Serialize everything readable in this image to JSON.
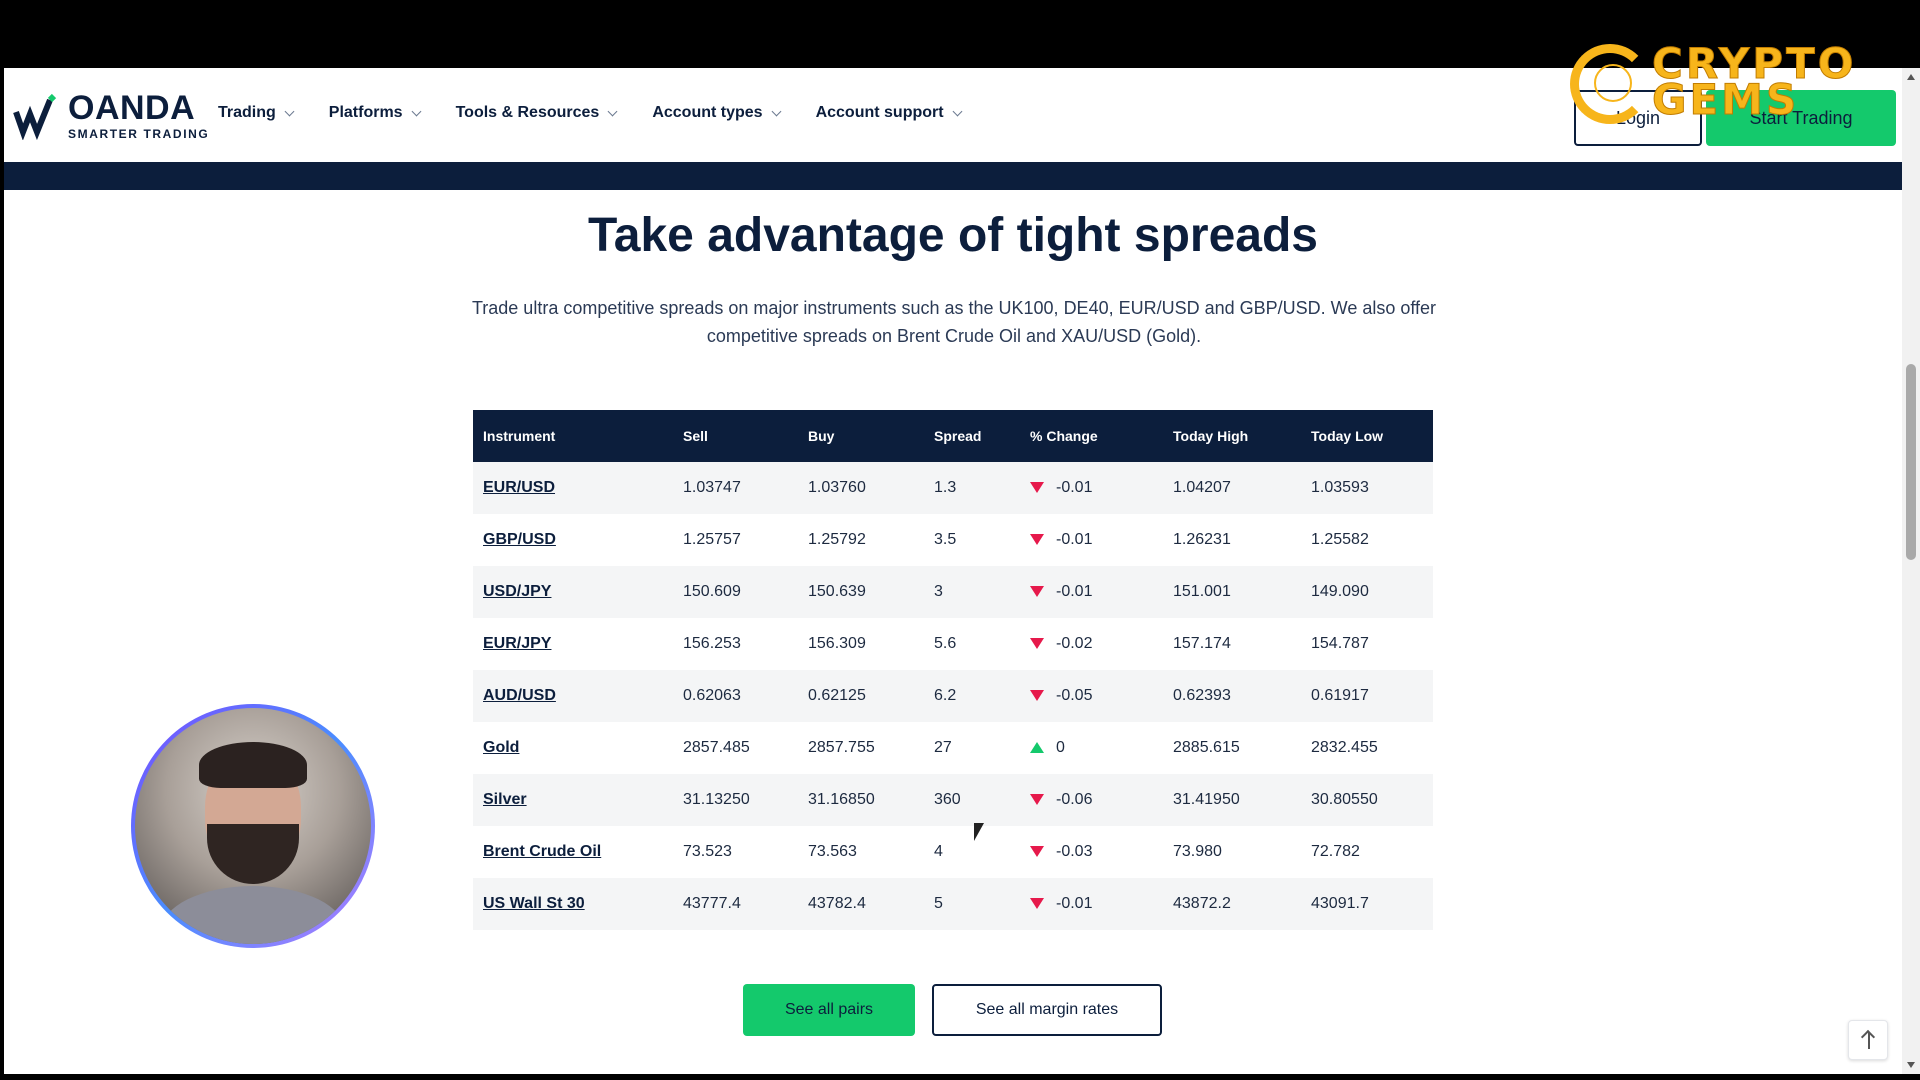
{
  "nav": {
    "logo_name": "OANDA",
    "logo_tagline": "SMARTER TRADING",
    "items": [
      {
        "label": "Trading"
      },
      {
        "label": "Platforms"
      },
      {
        "label": "Tools & Resources"
      },
      {
        "label": "Account types"
      },
      {
        "label": "Account support"
      }
    ],
    "login_label": "Login",
    "start_label": "Start Trading"
  },
  "watermark": {
    "text_line1": "CRYPTO",
    "text_line2": "GEMS"
  },
  "main": {
    "title": "Take advantage of tight spreads",
    "description": "Trade ultra competitive spreads on major instruments such as the UK100, DE40, EUR/USD and GBP/USD. We also offer competitive spreads on Brent Crude Oil and XAU/USD (Gold)."
  },
  "table": {
    "headers": [
      "Instrument",
      "Sell",
      "Buy",
      "Spread",
      "% Change",
      "Today High",
      "Today Low"
    ],
    "rows": [
      {
        "instrument": "EUR/USD",
        "sell": "1.03747",
        "buy": "1.03760",
        "spread": "1.3",
        "direction": "down",
        "change": "-0.01",
        "high": "1.04207",
        "low": "1.03593"
      },
      {
        "instrument": "GBP/USD",
        "sell": "1.25757",
        "buy": "1.25792",
        "spread": "3.5",
        "direction": "down",
        "change": "-0.01",
        "high": "1.26231",
        "low": "1.25582"
      },
      {
        "instrument": "USD/JPY",
        "sell": "150.609",
        "buy": "150.639",
        "spread": "3",
        "direction": "down",
        "change": "-0.01",
        "high": "151.001",
        "low": "149.090"
      },
      {
        "instrument": "EUR/JPY",
        "sell": "156.253",
        "buy": "156.309",
        "spread": "5.6",
        "direction": "down",
        "change": "-0.02",
        "high": "157.174",
        "low": "154.787"
      },
      {
        "instrument": "AUD/USD",
        "sell": "0.62063",
        "buy": "0.62125",
        "spread": "6.2",
        "direction": "down",
        "change": "-0.05",
        "high": "0.62393",
        "low": "0.61917"
      },
      {
        "instrument": "Gold",
        "sell": "2857.485",
        "buy": "2857.755",
        "spread": "27",
        "direction": "up",
        "change": "0",
        "high": "2885.615",
        "low": "2832.455"
      },
      {
        "instrument": "Silver",
        "sell": "31.13250",
        "buy": "31.16850",
        "spread": "360",
        "direction": "down",
        "change": "-0.06",
        "high": "31.41950",
        "low": "30.80550"
      },
      {
        "instrument": "Brent Crude Oil",
        "sell": "73.523",
        "buy": "73.563",
        "spread": "4",
        "direction": "down",
        "change": "-0.03",
        "high": "73.980",
        "low": "72.782"
      },
      {
        "instrument": "US Wall St 30",
        "sell": "43777.4",
        "buy": "43782.4",
        "spread": "5",
        "direction": "down",
        "change": "-0.01",
        "high": "43872.2",
        "low": "43091.7"
      }
    ]
  },
  "buttons": {
    "see_all_pairs": "See all pairs",
    "see_all_margin": "See all margin rates"
  },
  "colors": {
    "navy": "#0c1e3c",
    "green": "#14c96c",
    "down_red": "#e6194b",
    "watermark_gold": "#f7b51b"
  }
}
